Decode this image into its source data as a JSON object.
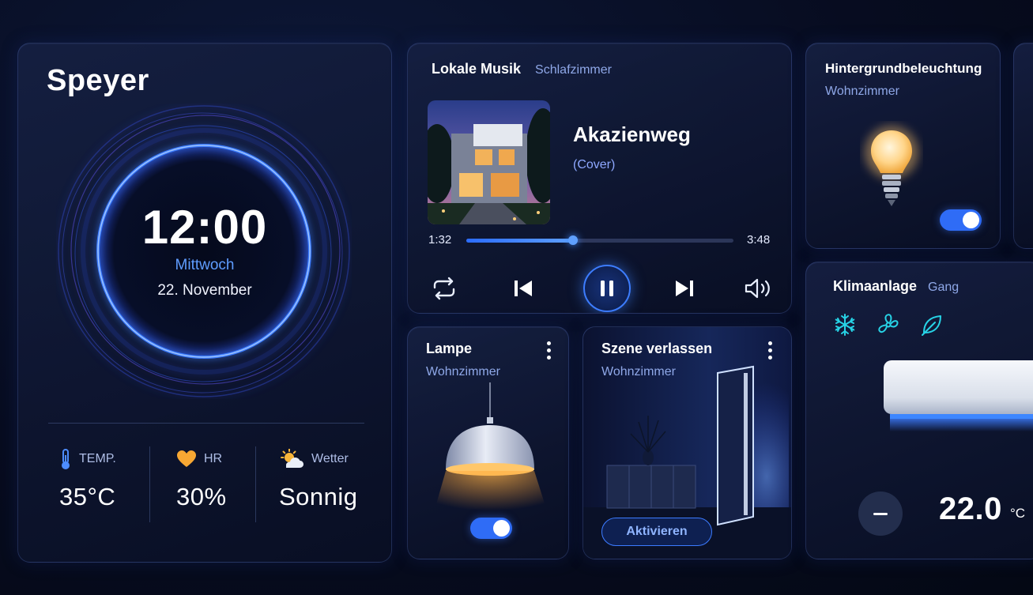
{
  "clock": {
    "city": "Speyer",
    "time": "12:00",
    "weekday": "Mittwoch",
    "date": "22. November",
    "stats": [
      {
        "icon": "thermometer-icon",
        "label": "TEMP.",
        "value": "35°C"
      },
      {
        "icon": "heart-icon",
        "label": "HR",
        "value": "30%"
      },
      {
        "icon": "sun-cloud-icon",
        "label": "Wetter",
        "value": "Sonnig"
      }
    ]
  },
  "music": {
    "title": "Lokale Musik",
    "room": "Schlafzimmer",
    "song": "Akazienweg",
    "song_sub": "(Cover)",
    "current_time": "1:32",
    "total_time": "3:48",
    "progress": 0.4
  },
  "lamp": {
    "title": "Lampe",
    "room": "Wohnzimmer",
    "on": true
  },
  "scene": {
    "title": "Szene verlassen",
    "room": "Wohnzimmer",
    "button": "Aktivieren"
  },
  "backlight": {
    "title": "Hintergrundbeleuchtung",
    "room": "Wohnzimmer",
    "on": true
  },
  "ac": {
    "title": "Klimaanlage",
    "room": "Gang",
    "modes": [
      "snowflake-icon",
      "fan-icon",
      "leaf-icon"
    ],
    "temperature": "22.0",
    "unit": "°C"
  },
  "colors": {
    "accent": "#2f6cf6",
    "ring": "#3d6dff",
    "background": "#070c20"
  }
}
